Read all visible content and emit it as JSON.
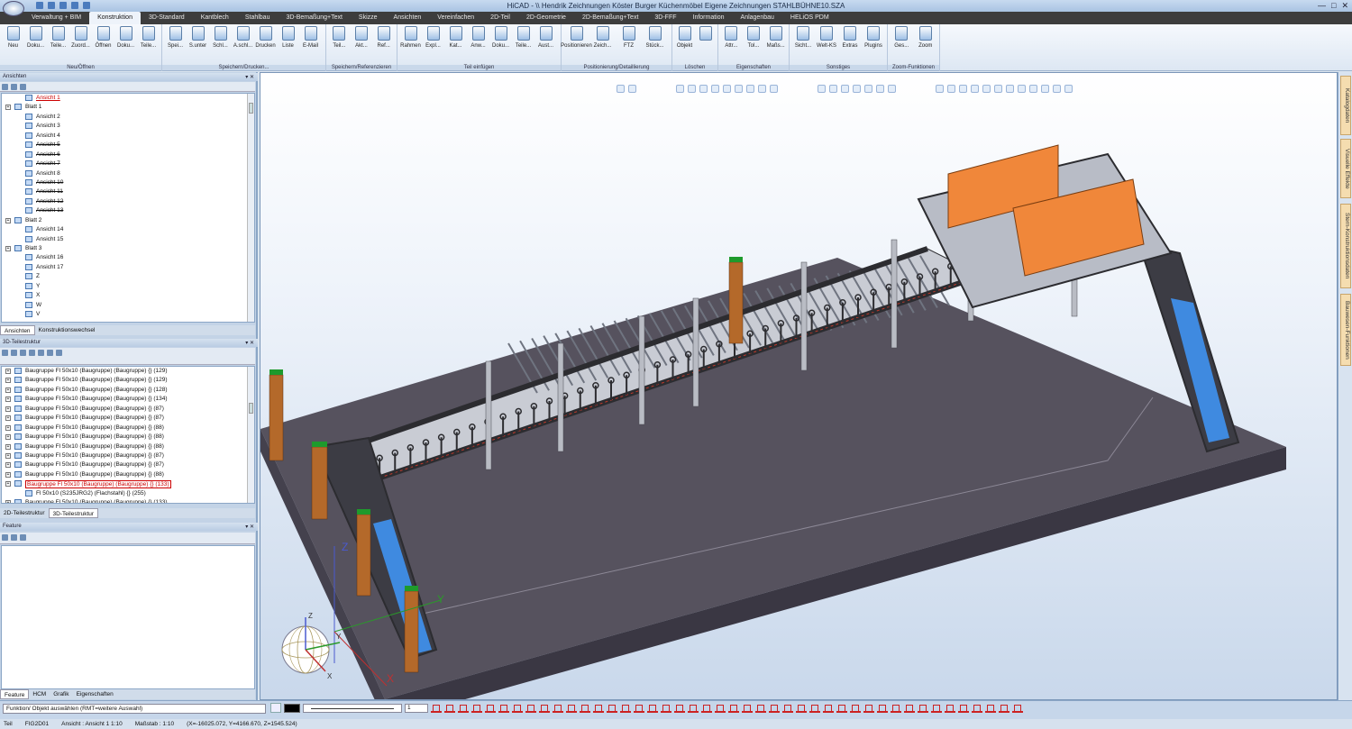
{
  "title_bar": {
    "text": "HiCAD - \\\\ Hendrik Zeichnungen Köster Burger Küchenmöbel Eigene Zeichnungen STAHLBÜHNE10.SZA",
    "controls": [
      "—",
      "□",
      "✕"
    ]
  },
  "menu_tabs": [
    "Verwaltung + BIM",
    "Konstruktion",
    "3D-Standard",
    "Kantblech",
    "Stahlbau",
    "3D-Bemaßung+Text",
    "Skizze",
    "Ansichten",
    "Vereinfachen",
    "2D-Teil",
    "2D-Geometrie",
    "2D-Bemaßung+Text",
    "3D-FFF",
    "Information",
    "Anlagenbau",
    "HELiOS PDM"
  ],
  "active_tab": "Konstruktion",
  "ribbon": {
    "groups": [
      {
        "label": "Neu/Öffnen",
        "buttons": [
          "Neu",
          "Doku...",
          "Teile...",
          "Zuord...",
          "Öffnen",
          "Doku...",
          "Teile..."
        ]
      },
      {
        "label": "Speichern/Drucken...",
        "buttons": [
          "Spei...",
          "S.unter",
          "Schl...",
          "A.schl...",
          "Drucken",
          "Liste",
          "E-Mail"
        ]
      },
      {
        "label": "Speichern/Referenzieren",
        "buttons": [
          "Teil...",
          "Akt...",
          "Ref..."
        ]
      },
      {
        "label": "Teil einfügen",
        "buttons": [
          "Rahmen",
          "Expl...",
          "Kat...",
          "Anw...",
          "Doku...",
          "Teile...",
          "Aust..."
        ]
      },
      {
        "label": "Positionierung/Detaillierung",
        "buttons": [
          "Positionieren",
          "Zeich...",
          "FTZ",
          "Stück..."
        ]
      },
      {
        "label": "Löschen",
        "buttons": [
          "Objekt",
          ""
        ]
      },
      {
        "label": "Eigenschaften",
        "buttons": [
          "Attr...",
          "Tol...",
          "Maßs..."
        ]
      },
      {
        "label": "Sonstiges",
        "buttons": [
          "Sicht...",
          "Welt-KS",
          "Extras",
          "Plugins"
        ]
      },
      {
        "label": "Zoom-Funktionen",
        "buttons": [
          "Ges...",
          "Zoom"
        ]
      }
    ]
  },
  "views_panel": {
    "title": "Ansichten",
    "nodes": [
      {
        "label": "Ansicht 1",
        "indent": 2,
        "state": "selected"
      },
      {
        "label": "Blatt 1",
        "indent": 1,
        "type": "sheet"
      },
      {
        "label": "Ansicht 2",
        "indent": 2
      },
      {
        "label": "Ansicht 3",
        "indent": 2
      },
      {
        "label": "Ansicht 4",
        "indent": 2
      },
      {
        "label": "Ansicht 5",
        "indent": 2,
        "state": "struck"
      },
      {
        "label": "Ansicht 6",
        "indent": 2,
        "state": "struck"
      },
      {
        "label": "Ansicht 7",
        "indent": 2,
        "state": "struck"
      },
      {
        "label": "Ansicht 8",
        "indent": 2
      },
      {
        "label": "Ansicht 10",
        "indent": 2,
        "state": "struck"
      },
      {
        "label": "Ansicht 11",
        "indent": 2,
        "state": "struck"
      },
      {
        "label": "Ansicht 12",
        "indent": 2,
        "state": "struck"
      },
      {
        "label": "Ansicht 13",
        "indent": 2,
        "state": "struck"
      },
      {
        "label": "Blatt 2",
        "indent": 1,
        "type": "sheet"
      },
      {
        "label": "Ansicht 14",
        "indent": 2
      },
      {
        "label": "Ansicht 15",
        "indent": 2
      },
      {
        "label": "Blatt 3",
        "indent": 1,
        "type": "sheet"
      },
      {
        "label": "Ansicht 16",
        "indent": 2
      },
      {
        "label": "Ansicht 17",
        "indent": 2
      },
      {
        "label": "Z",
        "indent": 2
      },
      {
        "label": "Y",
        "indent": 2
      },
      {
        "label": "X",
        "indent": 2
      },
      {
        "label": "W",
        "indent": 2
      },
      {
        "label": "V",
        "indent": 2
      }
    ],
    "tabs": [
      "Ansichten",
      "Konstruktionswechsel"
    ],
    "active_tab": "Ansichten"
  },
  "parts_panel": {
    "title": "3D-Teilestruktur",
    "nodes": [
      {
        "label": "Baugruppe Fl 50x10 (Baugruppe) (Baugruppe) {} (129)",
        "indent": 1
      },
      {
        "label": "Baugruppe Fl 50x10 (Baugruppe) (Baugruppe) {} (129)",
        "indent": 1
      },
      {
        "label": "Baugruppe Fl 50x10 (Baugruppe) (Baugruppe) {} (128)",
        "indent": 1
      },
      {
        "label": "Baugruppe Fl 50x10 (Baugruppe) (Baugruppe) {} (134)",
        "indent": 1
      },
      {
        "label": "Baugruppe Fl 50x10 (Baugruppe) (Baugruppe) {} (87)",
        "indent": 1
      },
      {
        "label": "Baugruppe Fl 50x10 (Baugruppe) (Baugruppe) {} (87)",
        "indent": 1
      },
      {
        "label": "Baugruppe Fl 50x10 (Baugruppe) (Baugruppe) {} (88)",
        "indent": 1
      },
      {
        "label": "Baugruppe Fl 50x10 (Baugruppe) (Baugruppe) {} (88)",
        "indent": 1
      },
      {
        "label": "Baugruppe Fl 50x10 (Baugruppe) (Baugruppe) {} (88)",
        "indent": 1
      },
      {
        "label": "Baugruppe Fl 50x10 (Baugruppe) (Baugruppe) {} (87)",
        "indent": 1
      },
      {
        "label": "Baugruppe Fl 50x10 (Baugruppe) (Baugruppe) {} (87)",
        "indent": 1
      },
      {
        "label": "Baugruppe Fl 50x10 (Baugruppe) (Baugruppe) {} (88)",
        "indent": 1
      },
      {
        "label": "Baugruppe Fl 50x10 (Baugruppe) (Baugruppe) {} (133)",
        "indent": 1,
        "state": "selbox"
      },
      {
        "label": "Fl 50x10 (S235JRG2) (Flachstahl) {} (255)",
        "indent": 2
      },
      {
        "label": "Baugruppe Fl 50x10 (Baugruppe) (Baugruppe) {} (133)",
        "indent": 1
      }
    ],
    "tabs": [
      "2D-Teilestruktur",
      "3D-Teilestruktur"
    ],
    "active_tab": "3D-Teilestruktur"
  },
  "feature_panel": {
    "title": "Feature",
    "tabs": [
      "Feature",
      "HCM",
      "Grafik",
      "Eigenschaften"
    ],
    "active_tab": "Feature"
  },
  "viewport": {
    "axis_labels": {
      "z": "Z",
      "y": "Y",
      "x": "X"
    },
    "triad_labels": {
      "z": "Z",
      "y": "Y",
      "x": "X"
    }
  },
  "right_dock_tabs": [
    "Katalogdaten",
    "Visuelle Effekte",
    "Stern-Konstruktionsdaten",
    "Bauwesen-Funktionen"
  ],
  "statusbar": {
    "function_prompt": "Funktion/ Objekt auswählen (RMT=weitere Auswahl)",
    "line_width": "1",
    "status_cells": [
      "Teil",
      "FIG2D01",
      "Ansicht : Ansicht 1 1:10",
      "Maßstab : 1:10",
      "(X=-16025.072, Y=4166.670, Z=1545.524)"
    ]
  },
  "colors": {
    "orange_block": "#f0873a",
    "floor": "#56525e",
    "frame_dark": "#2c2c30",
    "stair_blue": "#3f8ae0",
    "post_brown": "#b4692a",
    "post_cap": "#1e9a2c"
  }
}
